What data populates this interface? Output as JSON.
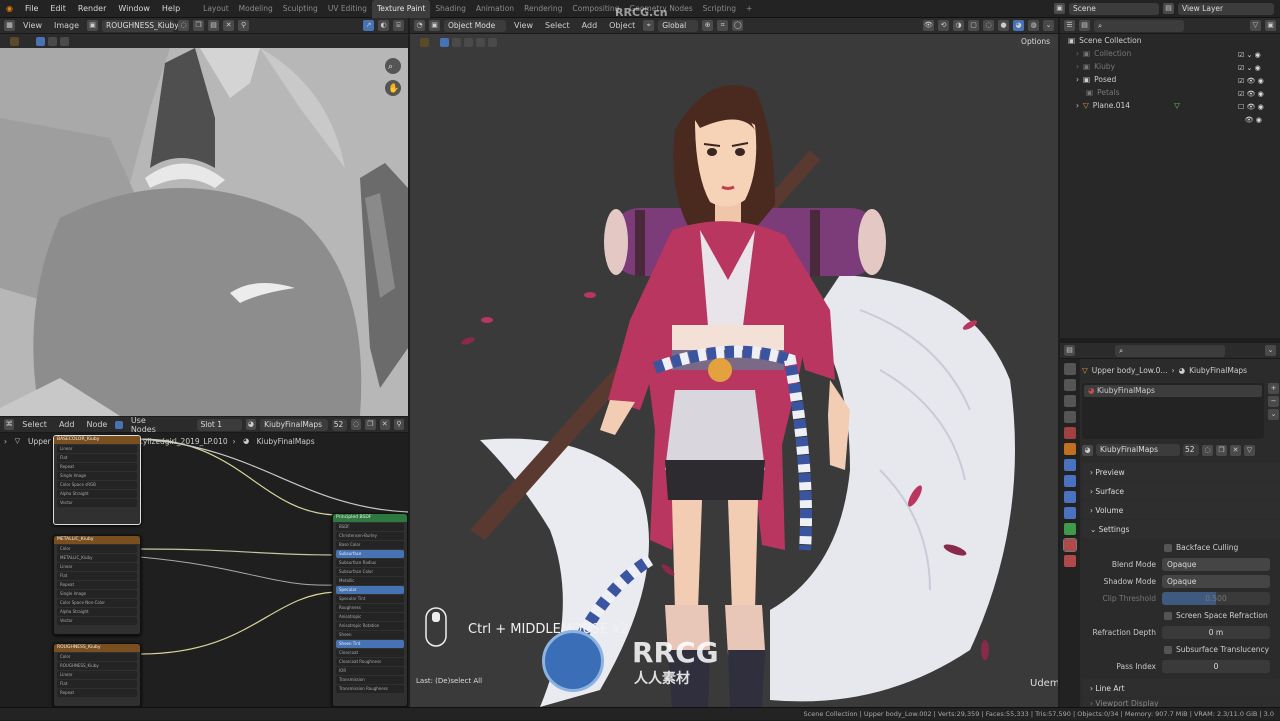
{
  "topbar": {
    "menus": [
      "File",
      "Edit",
      "Render",
      "Window",
      "Help"
    ],
    "workspaces": [
      "Layout",
      "Modeling",
      "Sculpting",
      "UV Editing",
      "Texture Paint",
      "Shading",
      "Animation",
      "Rendering",
      "Compositing",
      "Geometry Nodes",
      "Scripting"
    ],
    "active_workspace": "Texture Paint",
    "scene": "Scene",
    "view_layer": "View Layer"
  },
  "image_editor": {
    "view": "View",
    "image": "Image",
    "image_name": "ROUGHNESS_Kiuby"
  },
  "node_editor": {
    "select": "Select",
    "add": "Add",
    "node": "Node",
    "use_nodes": "Use Nodes",
    "slot": "Slot 1",
    "material": "KiubyFinalMaps",
    "users": "52",
    "breadcrumb_object": "Upper body_Low.002",
    "breadcrumb_mesh": "Stylizedgirl_2019_LP.010",
    "breadcrumb_material": "KiubyFinalMaps",
    "nodes": [
      {
        "title": "BASECOLOR_Kiuby",
        "rows": [
          "Color",
          "Alpha",
          "BASECOLOR_Kiuby",
          "Linear",
          "Flat",
          "Repeat",
          "Single Image",
          "Color Space  sRGB",
          "Alpha  Straight",
          "Vector"
        ]
      },
      {
        "title": "METALLIC_Kiuby",
        "rows": [
          "Color",
          "Alpha",
          "METALLIC_Kiuby",
          "Linear",
          "Flat",
          "Repeat",
          "Single Image",
          "Color Space  Non-Color",
          "Alpha  Straight",
          "Vector"
        ]
      },
      {
        "title": "ROUGHNESS_Kiuby",
        "rows": [
          "Color",
          "Alpha",
          "ROUGHNESS_Kiuby",
          "Linear",
          "Flat",
          "Repeat"
        ]
      },
      {
        "title": "Principled BSDF",
        "rows": [
          "BSDF",
          "Christensen-Burley",
          "Base Color",
          "Subsurface",
          "Subsurface Radius",
          "Subsurface Color",
          "Metallic",
          "Specular",
          "Specular Tint",
          "Roughness",
          "Anisotropic",
          "Anisotropic Rotation",
          "Sheen",
          "Sheen Tint",
          "Clearcoat",
          "Clearcoat Roughness",
          "IOR",
          "Transmission",
          "Transmission Roughness",
          "Emission",
          "Emission Strength"
        ]
      }
    ]
  },
  "viewport": {
    "mode": "Object Mode",
    "view": "View",
    "select": "Select",
    "add": "Add",
    "object": "Object",
    "transform": "Global",
    "options": "Options",
    "shortcut": "Ctrl + MIDDLEMOUSE x2",
    "last_op": "Last: (De)select All",
    "watermark_brand": "RRCG",
    "watermark_sub": "人人素材",
    "top_watermark": "RRCG.cn",
    "udemy": "Udemy"
  },
  "outliner": {
    "root": "Scene Collection",
    "items": [
      {
        "name": "Collection",
        "dim": true
      },
      {
        "name": "Kiuby",
        "dim": true
      },
      {
        "name": "Posed",
        "dim": false
      },
      {
        "name": "Petals",
        "dim": true
      },
      {
        "name": "Plane.014",
        "dim": false
      }
    ]
  },
  "properties": {
    "breadcrumb_object": "Upper body_Low.0...",
    "breadcrumb_material": "KiubyFinalMaps",
    "slot_name": "KiubyFinalMaps",
    "material_name": "KiubyFinalMaps",
    "users": "52",
    "sections": [
      "Preview",
      "Surface",
      "Volume",
      "Settings"
    ],
    "backface_culling": "Backface Culling",
    "blend_mode_label": "Blend Mode",
    "blend_mode": "Opaque",
    "shadow_mode_label": "Shadow Mode",
    "shadow_mode": "Opaque",
    "clip_threshold_label": "Clip Threshold",
    "clip_threshold": "0.500",
    "screen_space_refraction": "Screen Space Refraction",
    "refraction_depth_label": "Refraction Depth",
    "refraction_depth": "0 m",
    "subsurface_translucency": "Subsurface Translucency",
    "pass_index_label": "Pass Index",
    "pass_index": "0",
    "line_art": "Line Art",
    "viewport_display": "Viewport Display"
  },
  "statusbar": {
    "text": "Scene Collection | Upper body_Low.002 | Verts:29,359 | Faces:55,333 | Tris:57,590 | Objects:0/34 | Memory: 907.7 MiB | VRAM: 2.3/11.0 GiB | 3.0"
  },
  "colors": {
    "accent": "#4772b3",
    "kimono": "#b8365f",
    "obi_purple": "#7c3b79",
    "bg_viewport": "#3a3a3a"
  }
}
